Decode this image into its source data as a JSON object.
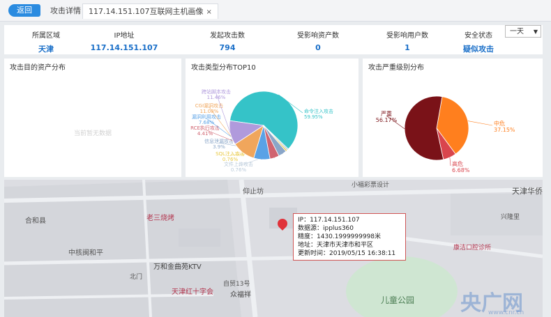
{
  "topbar": {
    "back_label": "返回",
    "tab_detail": "攻击详情",
    "tab_host": "117.14.151.107互联网主机画像",
    "tab_close": "×"
  },
  "stats": [
    {
      "label": "所属区域",
      "value": "天津"
    },
    {
      "label": "IP地址",
      "value": "117.14.151.107"
    },
    {
      "label": "发起攻击数",
      "value": "794"
    },
    {
      "label": "受影响资产数",
      "value": "0"
    },
    {
      "label": "受影响用户数",
      "value": "1"
    },
    {
      "label": "安全状态",
      "value": "疑似攻击"
    }
  ],
  "range_select": {
    "value": "一天",
    "arrow": "▼"
  },
  "panels": {
    "assets": {
      "title": "攻击目的资产分布",
      "empty_text": "当前暂无数据"
    },
    "types": {
      "title": "攻击类型分布TOP10"
    },
    "severity": {
      "title": "攻击严重级别分布"
    }
  },
  "chart_data": [
    {
      "type": "pie",
      "title": "攻击类型分布TOP10",
      "slices": [
        {
          "name": "命令注入攻击",
          "pct_label": "59.95%",
          "value": 59.95,
          "color": "#35c3c8"
        },
        {
          "name": "文件上传攻击",
          "pct_label": "0.76%",
          "value": 0.76,
          "color": "#b8c9d9"
        },
        {
          "name": "SQL注入攻击",
          "pct_label": "0.76%",
          "value": 0.76,
          "color": "#e8c840"
        },
        {
          "name": "信息泄漏攻击",
          "pct_label": "3.9%",
          "value": 3.9,
          "color": "#8aa6c8"
        },
        {
          "name": "RCE执行攻击",
          "pct_label": "4.41%",
          "value": 4.41,
          "color": "#d06470"
        },
        {
          "name": "漏洞利用攻击",
          "pct_label": "7.68%",
          "value": 7.68,
          "color": "#5aa2e6"
        },
        {
          "name": "CGI漏洞攻击",
          "pct_label": "11.08%",
          "value": 11.08,
          "color": "#f0a65c"
        },
        {
          "name": "跨站脚本攻击",
          "pct_label": "11.46%",
          "value": 11.46,
          "color": "#b09adc"
        }
      ]
    },
    {
      "type": "pie",
      "title": "攻击严重级别分布",
      "slices": [
        {
          "name": "中危",
          "pct_label": "37.15%",
          "value": 37.15,
          "color": "#ff7f1e"
        },
        {
          "name": "高危",
          "pct_label": "6.68%",
          "value": 6.68,
          "color": "#d9454d"
        },
        {
          "name": "严重",
          "pct_label": "56.17%",
          "value": 56.17,
          "color": "#7a1218"
        }
      ]
    }
  ],
  "map": {
    "labels": [
      "合和县",
      "中核闽和平",
      "老三烧烤",
      "万和金曲苑KTV",
      "天津红十字会",
      "众福祥",
      "仰止坊",
      "儿童公园",
      "康洁口腔诊所",
      "兴隆里",
      "天津华侨",
      "小福彩票设计",
      "自贸13号",
      "北门",
      "北门"
    ],
    "popup": {
      "ip": "IP：117.14.151.107",
      "source": "数据源：ipplus360",
      "accuracy": "精度：1430.1999999998米",
      "address": "地址：天津市天津市和平区",
      "updated": "更新时间：2019/05/15 16:38:11"
    },
    "watermark": "央广网",
    "watermark_small": "www.cnr.cn"
  }
}
